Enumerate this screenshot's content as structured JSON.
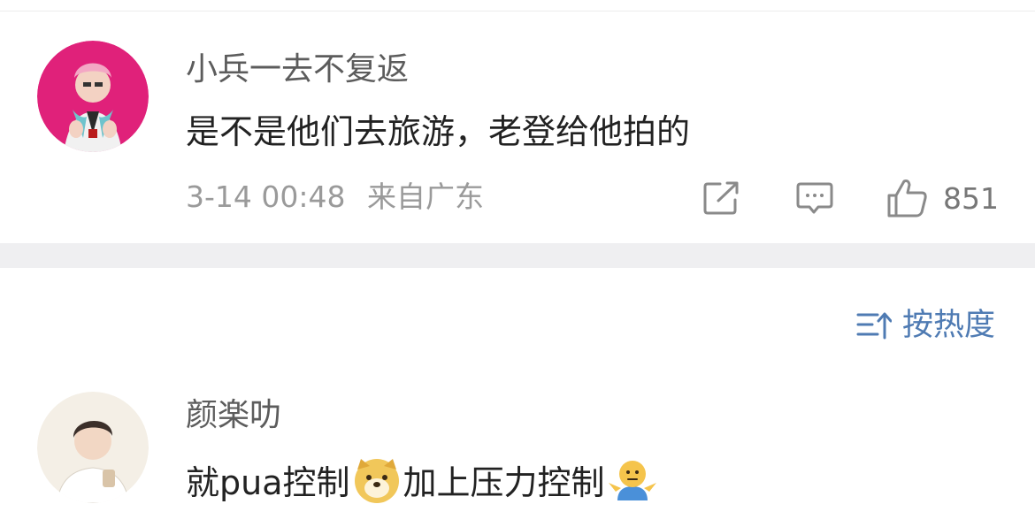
{
  "top_comment": {
    "username": "小兵一去不复返",
    "content": "是不是他们去旅游，老登给他拍的",
    "time": "3-14 00:48",
    "location": "来自广东",
    "likes": "851",
    "avatar_bg": "#e0217a"
  },
  "sort": {
    "label": "按热度"
  },
  "comment2": {
    "username": "颜楽叻",
    "text_before": "就pua控制",
    "text_after": "加上压力控制",
    "emoji1": "doge",
    "emoji2": "shrug"
  },
  "colors": {
    "link_blue": "#4f7bb3",
    "divider": "#efeff1"
  }
}
